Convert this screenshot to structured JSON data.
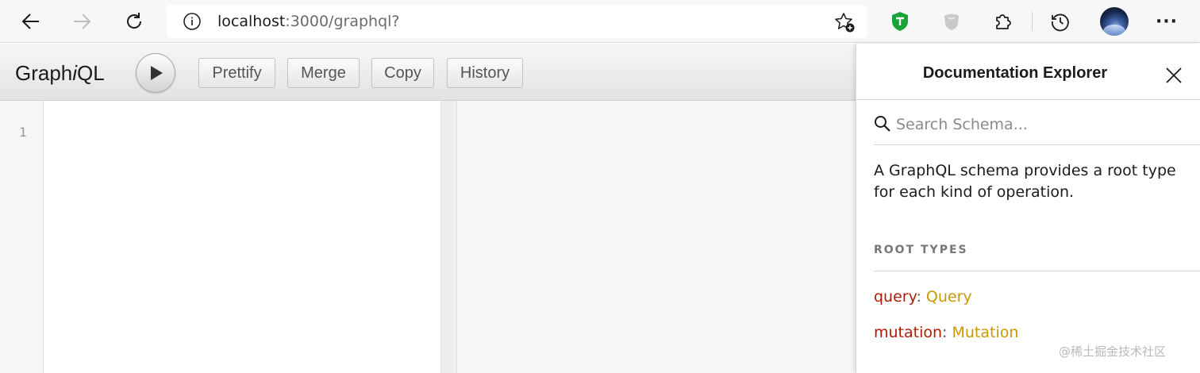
{
  "browser": {
    "url_host": "localhost",
    "url_path": ":3000/graphql?",
    "more_label": "···",
    "icons": {
      "back": "back-arrow-icon",
      "forward": "forward-arrow-icon",
      "refresh": "refresh-icon",
      "info": "info-icon",
      "favorite": "add-favorite-icon",
      "ext_shield": "shield-extension-icon",
      "ext_grey": "extension-icon",
      "extensions": "puzzle-icon",
      "history": "history-icon",
      "profile": "avatar"
    }
  },
  "graphiql": {
    "title_prefix": "Graph",
    "title_italic": "i",
    "title_suffix": "QL",
    "buttons": {
      "prettify": "Prettify",
      "merge": "Merge",
      "copy": "Copy",
      "history": "History"
    },
    "editor": {
      "line_numbers": [
        "1"
      ]
    }
  },
  "docs": {
    "title": "Documentation Explorer",
    "search_placeholder": "Search Schema...",
    "description": "A GraphQL schema provides a root type for each kind of operation.",
    "section_title": "ROOT TYPES",
    "root_types": [
      {
        "field": "query",
        "type": "Query"
      },
      {
        "field": "mutation",
        "type": "Mutation"
      }
    ]
  },
  "watermark": "@稀土掘金技术社区",
  "colors": {
    "field_name": "#b11a04",
    "type_name": "#ca9800",
    "shield_green": "#1aa336"
  }
}
